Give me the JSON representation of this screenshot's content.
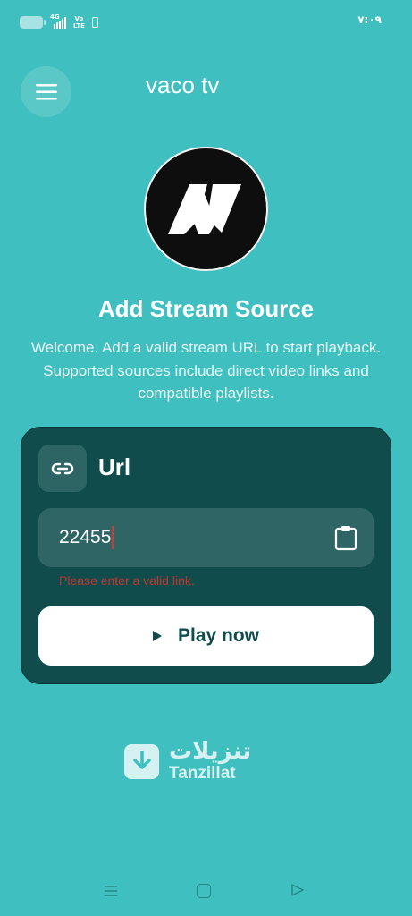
{
  "status_bar": {
    "network": "4G",
    "volte_line1": "Vo",
    "volte_line2": "LTE",
    "time": "٧:٠٩"
  },
  "header": {
    "title": "vaco tv",
    "menu_icon": "hamburger-menu-icon"
  },
  "hero": {
    "logo_icon": "n-logo-icon",
    "heading": "Add Stream Source",
    "description": "Welcome. Add a valid stream URL to start playback. Supported sources include direct video links and compatible playlists."
  },
  "card": {
    "icon": "link-icon",
    "title": "Url",
    "input_value": "22455",
    "paste_icon": "clipboard-icon",
    "error": "Please enter a valid link.",
    "play_label": "Play now",
    "play_icon": "play-icon"
  },
  "watermark": {
    "arabic": "تنزيلات",
    "latin": "Tanzillat",
    "icon": "download-icon"
  },
  "nav": {
    "recent_icon": "recent-apps-icon",
    "home_icon": "home-icon",
    "back_icon": "back-icon"
  },
  "colors": {
    "background": "#3fbfbf",
    "card": "#0f4c4b",
    "field": "#2f6564",
    "error": "#c8332c",
    "button": "#ffffff"
  }
}
